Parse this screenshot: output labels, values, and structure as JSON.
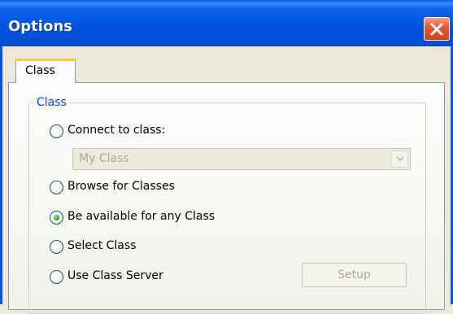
{
  "window": {
    "title": "Options",
    "close_icon": "close-icon"
  },
  "tabs": [
    {
      "label": "Class",
      "selected": true
    }
  ],
  "group": {
    "legend": "Class",
    "options": [
      {
        "label": "Connect to class:",
        "checked": false
      },
      {
        "label": "Browse for Classes",
        "checked": false
      },
      {
        "label": "Be available for any Class",
        "checked": true
      },
      {
        "label": "Select Class",
        "checked": false
      },
      {
        "label": "Use Class Server",
        "checked": false
      }
    ],
    "class_combo": {
      "value": "My Class",
      "enabled": false
    },
    "setup_button": {
      "label": "Setup",
      "enabled": false
    }
  },
  "colors": {
    "titlebar": "#0054e3",
    "tab_highlight": "#ffc83c",
    "group_legend": "#0046d5",
    "disabled_text": "#aca899",
    "radio_dot": "#2ea62e"
  }
}
